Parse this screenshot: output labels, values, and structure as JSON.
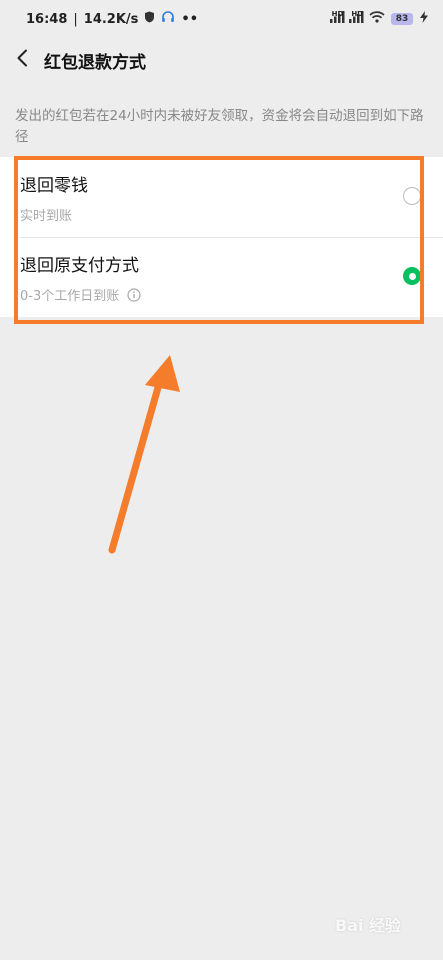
{
  "status_bar": {
    "time": "16:48",
    "net_speed": "14.2K/s",
    "battery": "83",
    "signal1": "HD",
    "signal2": "HD"
  },
  "nav": {
    "title": "红包退款方式"
  },
  "description": "发出的红包若在24小时内未被好友领取，资金将会自动退回到如下路径",
  "options": [
    {
      "title": "退回零钱",
      "subtitle": "实时到账",
      "selected": false
    },
    {
      "title": "退回原支付方式",
      "subtitle": "0-3个工作日到账",
      "selected": true
    }
  ],
  "watermark": "Bai 经验",
  "colors": {
    "accent_green": "#07c160",
    "highlight_orange": "#f47c2b",
    "background": "#ededed"
  },
  "icons": [
    "back-arrow-icon",
    "shield-icon",
    "headset-icon",
    "signal-icon",
    "wifi-icon",
    "charging-icon",
    "info-icon"
  ]
}
